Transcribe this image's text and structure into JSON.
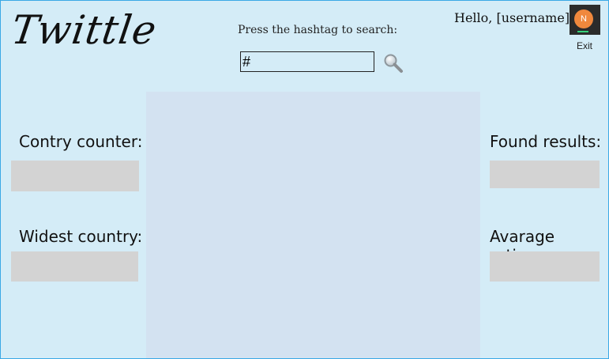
{
  "header": {
    "logo": "Twittle",
    "search_prompt": "Press the hashtag to search:",
    "search_value": "#",
    "greeting": "Hello, [username]",
    "avatar_initial": "N",
    "exit_label": "Exit"
  },
  "left_panel": {
    "country_counter_label": "Contry counter:",
    "country_counter_value": "",
    "widest_country_label": "Widest country:",
    "widest_country_value": ""
  },
  "right_panel": {
    "found_results_label": "Found results:",
    "found_results_value": "",
    "average_rating_label": "Avarage rating:",
    "average_rating_value": ""
  },
  "icons": {
    "search": "magnifier-icon",
    "avatar": "user-avatar-icon"
  },
  "colors": {
    "page_background": "#d4ecf7",
    "feed_background": "#d3e2f1",
    "stat_box": "#d3d3d3",
    "avatar": "#f0883d",
    "border_accent": "#3aa8e6"
  }
}
